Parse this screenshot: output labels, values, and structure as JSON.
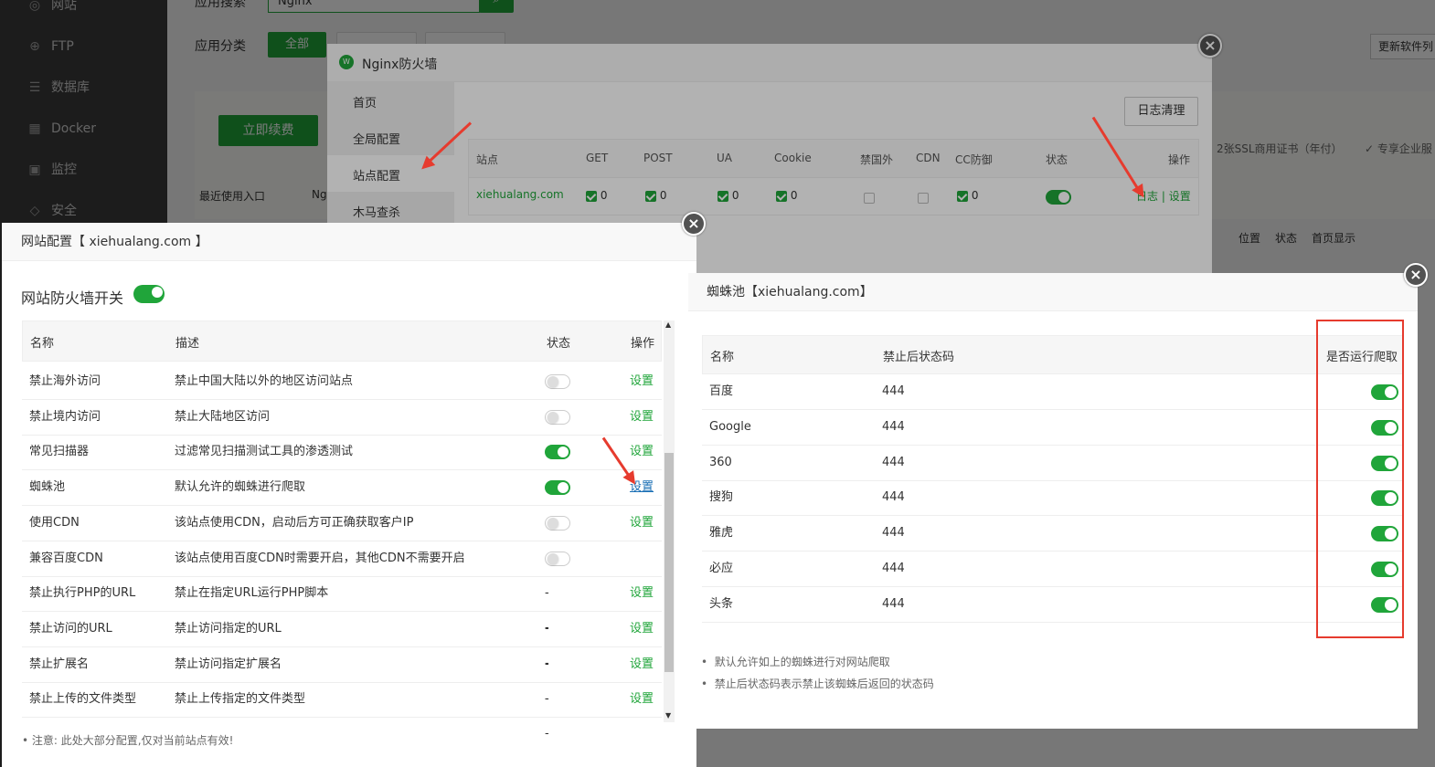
{
  "sidebar": {
    "items": [
      {
        "label": "网站",
        "icon": "globe-icon"
      },
      {
        "label": "FTP",
        "icon": "ftp-icon"
      },
      {
        "label": "数据库",
        "icon": "database-icon"
      },
      {
        "label": "Docker",
        "icon": "docker-icon"
      },
      {
        "label": "监控",
        "icon": "monitor-icon"
      },
      {
        "label": "安全",
        "icon": "shield-icon"
      }
    ]
  },
  "background": {
    "search_label": "应用搜索",
    "search_value": "Nginx",
    "category_label": "应用分类",
    "category_all": "全部",
    "update_button": "更新软件列",
    "renew_button": "立即续费",
    "recent_label": "最近使用入口",
    "recent_item": "Ng",
    "ssl_text": "2张SSL商用证书（年付）",
    "enterprise_text": "✓ 专享企业服",
    "list_headers": [
      "位置",
      "状态",
      "首页显示"
    ]
  },
  "firewall": {
    "title": "Nginx防火墙",
    "nav": [
      "首页",
      "全局配置",
      "站点配置",
      "木马查杀"
    ],
    "log_clear_button": "日志清理",
    "headers": [
      "站点",
      "GET",
      "POST",
      "UA",
      "Cookie",
      "禁国外",
      "CDN",
      "CC防御",
      "状态",
      "操作"
    ],
    "row": {
      "site": "xiehualang.com",
      "get": "0",
      "post": "0",
      "ua": "0",
      "cookie": "0",
      "cc": "0",
      "log_link": "日志",
      "sep": "|",
      "set_link": "设置"
    }
  },
  "site_config": {
    "title": "网站配置【 xiehualang.com 】",
    "switch_label": "网站防火墙开关",
    "headers": {
      "name": "名称",
      "desc": "描述",
      "status": "状态",
      "action": "操作"
    },
    "rows": [
      {
        "name": "禁止海外访问",
        "desc": "禁止中国大陆以外的地区访问站点",
        "status": "off",
        "action": "设置"
      },
      {
        "name": "禁止境内访问",
        "desc": "禁止大陆地区访问",
        "status": "off",
        "action": "设置"
      },
      {
        "name": "常见扫描器",
        "desc": "过滤常见扫描测试工具的渗透测试",
        "status": "on",
        "action": "设置"
      },
      {
        "name": "蜘蛛池",
        "desc": "默认允许的蜘蛛进行爬取",
        "status": "on",
        "action": "设置"
      },
      {
        "name": "使用CDN",
        "desc": "该站点使用CDN，启动后方可正确获取客户IP",
        "status": "off",
        "action": "设置"
      },
      {
        "name": "兼容百度CDN",
        "desc": "该站点使用百度CDN时需要开启，其他CDN不需要开启",
        "status": "off",
        "action": ""
      },
      {
        "name": "禁止执行PHP的URL",
        "desc": "禁止在指定URL运行PHP脚本",
        "status": "--",
        "action": "设置"
      },
      {
        "name": "禁止访问的URL",
        "desc": "禁止访问指定的URL",
        "status": "--",
        "action": "设置"
      },
      {
        "name": "禁止扩展名",
        "desc": "禁止访问指定扩展名",
        "status": "--",
        "action": "设置"
      },
      {
        "name": "禁止上传的文件类型",
        "desc": "禁止上传指定的文件类型",
        "status": "--",
        "action": "设置"
      }
    ],
    "note": "注意: 此处大部分配置,仅对当前站点有效!"
  },
  "spider": {
    "title": "蜘蛛池【xiehualang.com】",
    "headers": {
      "name": "名称",
      "code": "禁止后状态码",
      "run": "是否运行爬取"
    },
    "rows": [
      {
        "name": "百度",
        "code": "444"
      },
      {
        "name": "Google",
        "code": "444"
      },
      {
        "name": "360",
        "code": "444"
      },
      {
        "name": "搜狗",
        "code": "444"
      },
      {
        "name": "雅虎",
        "code": "444"
      },
      {
        "name": "必应",
        "code": "444"
      },
      {
        "name": "头条",
        "code": "444"
      }
    ],
    "notes": [
      "默认允许如上的蜘蛛进行对网站爬取",
      "禁止后状态码表示禁止该蜘蛛后返回的状态码"
    ]
  },
  "colors": {
    "accent": "#20a53a",
    "annotation": "#e63b2e"
  }
}
